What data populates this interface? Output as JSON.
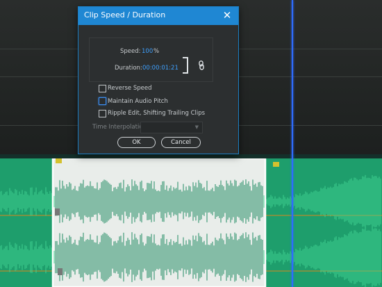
{
  "dialog": {
    "title": "Clip Speed / Duration",
    "close_glyph": "✕",
    "speed_label": "Speed:",
    "speed_value": "100",
    "speed_unit": "%",
    "duration_label": "Duration:",
    "duration_value": "00:00:01:21",
    "link_icon": "chain-link-icon",
    "checkboxes": [
      {
        "label": "Reverse Speed",
        "checked": false
      },
      {
        "label": "Maintain Audio Pitch",
        "checked": false,
        "focused": true
      },
      {
        "label": "Ripple Edit, Shifting Trailing Clips",
        "checked": false
      }
    ],
    "time_interpolation_label": "Time Interpolation:",
    "ok_label": "OK",
    "cancel_label": "Cancel"
  },
  "timeline": {
    "clip_badge_glyph": "fx"
  },
  "colors": {
    "accent": "#1f87d3",
    "value_blue": "#3fa1ff",
    "waveform_green": "#27b57f",
    "selected_clip": "#e8ece9",
    "playhead": "#2e6cff"
  }
}
